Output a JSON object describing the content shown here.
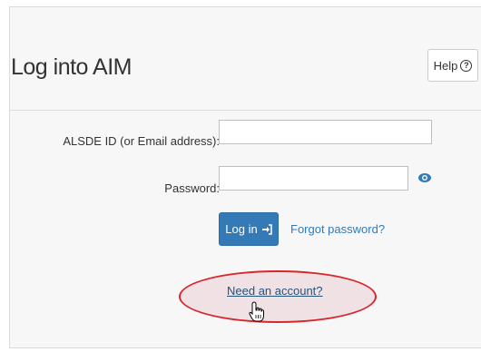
{
  "header": {
    "title": "Log into AIM",
    "help_label": "Help",
    "help_icon": "question-circle-icon"
  },
  "form": {
    "username_label": "ALSDE ID (or Email address):",
    "username_value": "",
    "password_label": "Password:",
    "password_value": "",
    "show_password_icon": "eye-icon",
    "login_label": "Log in",
    "login_icon": "sign-in-icon",
    "forgot_label": "Forgot password?",
    "need_account_label": "Need an account?"
  },
  "colors": {
    "primary": "#337ab7",
    "link": "#337ab7",
    "annotation": "#d8262c"
  }
}
